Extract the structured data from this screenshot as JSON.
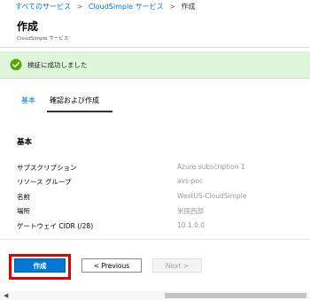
{
  "breadcrumb": {
    "items": [
      "すべてのサービス",
      "CloudSimple サービス"
    ],
    "separator": ">",
    "current": "作成"
  },
  "header": {
    "title": "作成",
    "subtitle": "CloudSimple サービス"
  },
  "banner": {
    "message": "検証に成功しました",
    "icon": "success-check-icon",
    "color": "#dff6dd"
  },
  "tabs": [
    {
      "label": "基本",
      "active": false
    },
    {
      "label": "確認および作成",
      "active": true
    }
  ],
  "section": {
    "title": "基本",
    "rows": [
      {
        "label": "サブスクリプション",
        "value": "Azure subscription 1"
      },
      {
        "label": "リソース グループ",
        "value": "avs-poc"
      },
      {
        "label": "名前",
        "value": "WestUS-CloudSimple"
      },
      {
        "label": "場所",
        "value": "米国西部"
      },
      {
        "label": "ゲートウェイ CIDR (/28)",
        "value": "10.1.0.0"
      }
    ]
  },
  "footer": {
    "create_label": "作成",
    "previous_label": "< Previous",
    "next_label": "Next >"
  },
  "colors": {
    "accent": "#0078d4",
    "highlight": "#e00000"
  }
}
